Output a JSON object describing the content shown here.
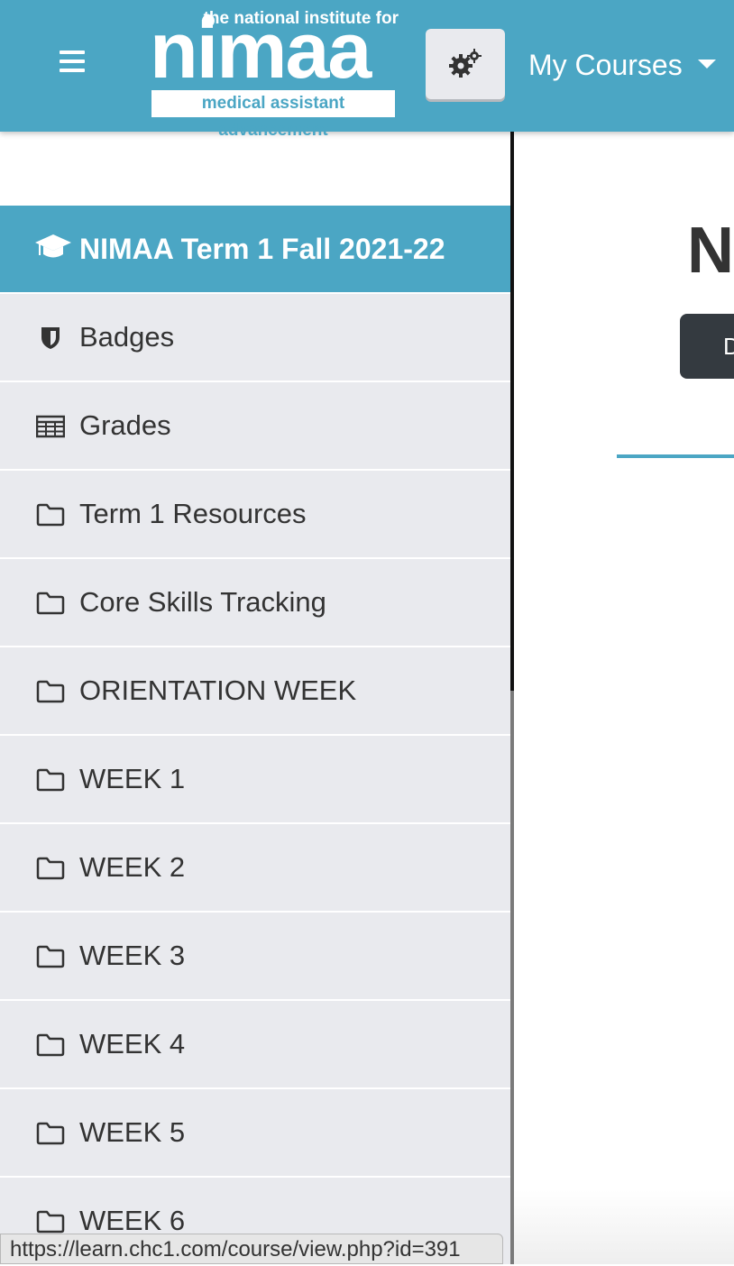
{
  "header": {
    "logo": {
      "tagline": "the national institute for",
      "wordmark": "nimaa",
      "subtitle": "medical assistant advancement"
    },
    "menu_icon": "hamburger-menu-icon",
    "settings_icon": "gears-icon",
    "my_courses_label": "My Courses",
    "colors": {
      "bar": "#4ba6c4",
      "button": "#e9eaee"
    }
  },
  "sidebar": {
    "course_title": "NIMAA Term 1 Fall 2021-22",
    "course_icon": "graduation-cap-icon",
    "items": [
      {
        "label": "Badges",
        "icon": "shield-icon"
      },
      {
        "label": "Grades",
        "icon": "table-icon"
      },
      {
        "label": "Term 1 Resources",
        "icon": "folder-icon"
      },
      {
        "label": "Core Skills Tracking",
        "icon": "folder-icon"
      },
      {
        "label": "ORIENTATION WEEK",
        "icon": "folder-icon"
      },
      {
        "label": "WEEK 1",
        "icon": "folder-icon"
      },
      {
        "label": "WEEK 2",
        "icon": "folder-icon"
      },
      {
        "label": "WEEK 3",
        "icon": "folder-icon"
      },
      {
        "label": "WEEK 4",
        "icon": "folder-icon"
      },
      {
        "label": "WEEK 5",
        "icon": "folder-icon"
      },
      {
        "label": "WEEK 6",
        "icon": "folder-icon"
      }
    ],
    "colors": {
      "active": "#4ba6c4",
      "item_bg": "#e9eaee"
    }
  },
  "main": {
    "heading_partial": "N",
    "button_partial": "D"
  },
  "status_bar": {
    "url": "https://learn.chc1.com/course/view.php?id=391"
  }
}
